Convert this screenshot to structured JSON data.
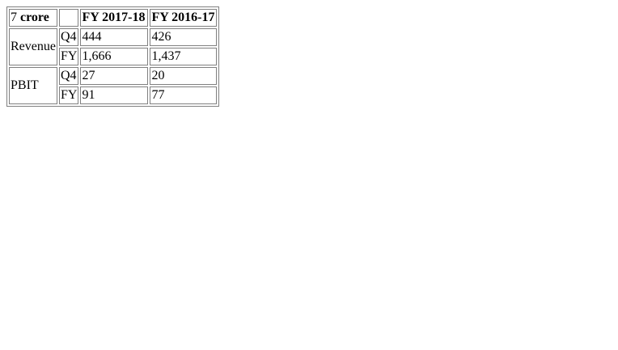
{
  "table": {
    "corner": {
      "prefix": "7",
      "unit": "crore"
    },
    "headers": [
      "FY 2017-18",
      "FY 2016-17"
    ],
    "rows": [
      {
        "metric": "Revenue",
        "q4": {
          "period": "Q4",
          "values": [
            "444",
            "426"
          ]
        },
        "fy": {
          "period": "FY",
          "values": [
            "1,666",
            "1,437"
          ]
        }
      },
      {
        "metric": "PBIT",
        "q4": {
          "period": "Q4",
          "values": [
            "27",
            "20"
          ]
        },
        "fy": {
          "period": "FY",
          "values": [
            "91",
            "77"
          ]
        }
      }
    ]
  }
}
